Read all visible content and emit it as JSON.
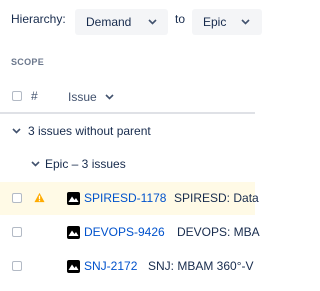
{
  "hierarchy": {
    "label": "Hierarchy:",
    "from_value": "Demand",
    "to_label": "to",
    "to_value": "Epic"
  },
  "scope": {
    "title": "SCOPE",
    "columns": {
      "hash": "#",
      "issue": "Issue"
    }
  },
  "groups": {
    "no_parent": "3 issues without parent",
    "epic": "Epic – 3 issues"
  },
  "rows": [
    {
      "key": "SPIRESD-1178",
      "summary": "SPIRESD: Data",
      "warning": true
    },
    {
      "key": "DEVOPS-9426",
      "summary": "DEVOPS: MBA",
      "warning": false
    },
    {
      "key": "SNJ-2172",
      "summary": "SNJ: MBAM 360°-V",
      "warning": false
    }
  ],
  "colors": {
    "link": "#0052cc",
    "highlight_row": "#fffae6",
    "warning": "#ffab00"
  }
}
